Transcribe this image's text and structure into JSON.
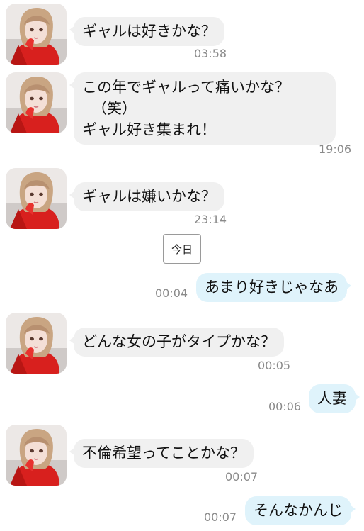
{
  "messages": [
    {
      "text": "ギャルは好きかな？",
      "time": "03:58"
    },
    {
      "lines": [
        "この年でギャルって痛いかな？",
        "（笑）",
        "ギャル好き集まれ！"
      ],
      "time": "19:06"
    },
    {
      "text": "ギャルは嫌いかな？",
      "time": "23:14"
    },
    {
      "text": "あまり好きじゃなあ",
      "time": "00:04"
    },
    {
      "text": "どんな女の子がタイプかな？",
      "time": "00:05"
    },
    {
      "text": "人妻",
      "time": "00:06"
    },
    {
      "text": "不倫希望ってことかな？",
      "time": "00:07"
    },
    {
      "text": "そんなかんじ",
      "time": "00:07"
    }
  ],
  "date_divider": "今日",
  "colors": {
    "incoming_bubble": "#f0f0f0",
    "outgoing_bubble": "#dff3fb",
    "timestamp": "#8a8a8a"
  }
}
